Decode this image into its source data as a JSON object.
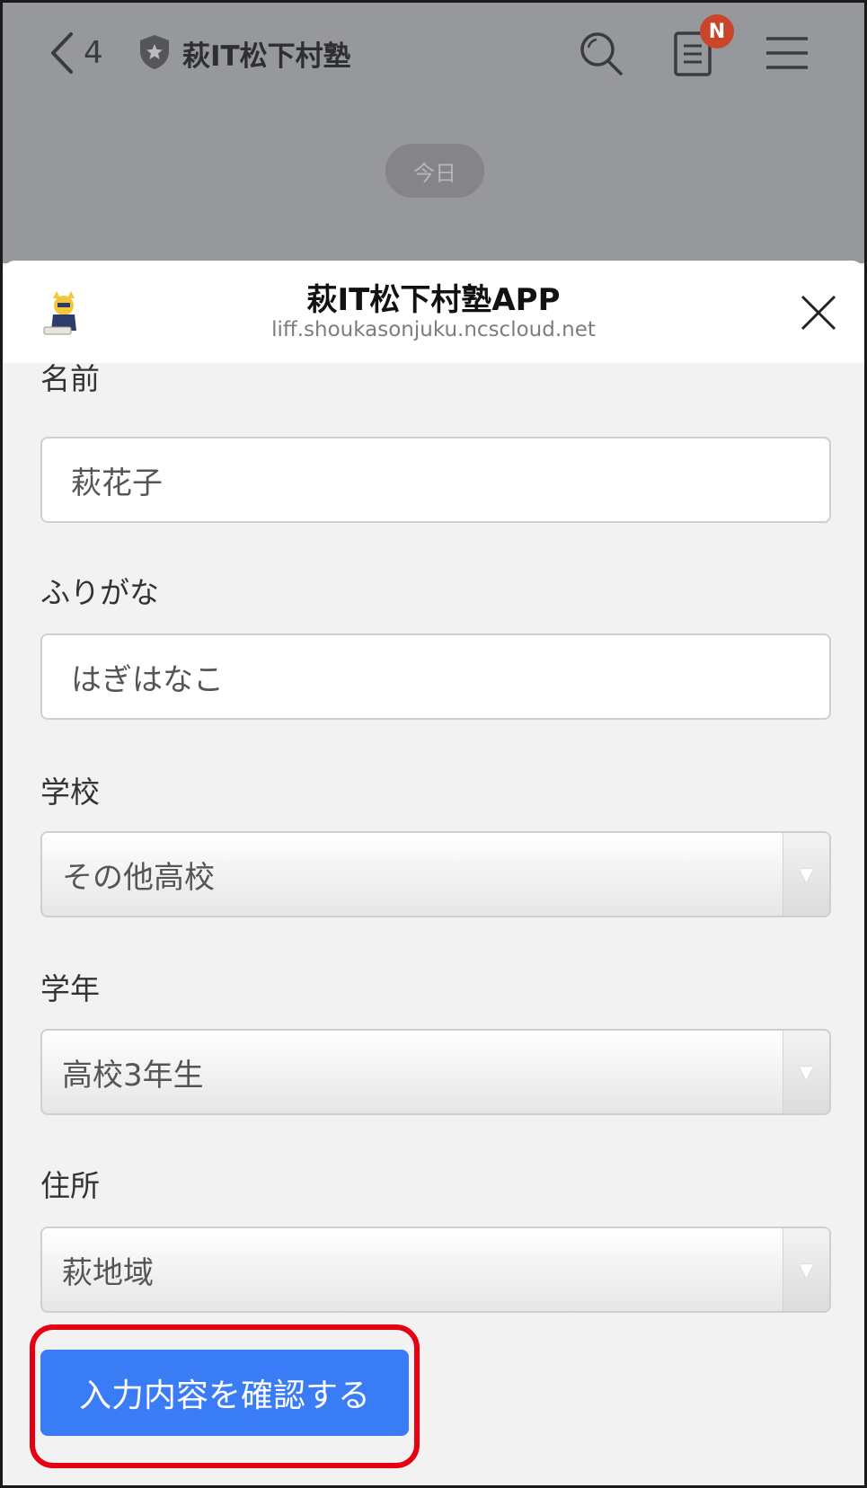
{
  "chat_header": {
    "back_count": "4",
    "title": "萩IT松下村塾",
    "notes_badge": "N",
    "date_pill": "今日"
  },
  "sheet": {
    "title": "萩IT松下村塾APP",
    "url": "liff.shoukasonjuku.ncscloud.net"
  },
  "form": {
    "name": {
      "label": "名前",
      "value": "萩花子"
    },
    "furigana": {
      "label": "ふりがな",
      "value": "はぎはなこ"
    },
    "school": {
      "label": "学校",
      "value": "その他高校"
    },
    "grade": {
      "label": "学年",
      "value": "高校3年生"
    },
    "address": {
      "label": "住所",
      "value": "萩地域"
    },
    "submit_label": "入力内容を確認する"
  },
  "colors": {
    "accent": "#3a7cf5",
    "highlight": "#e50012",
    "badge": "#c9462b"
  },
  "icons": [
    "back-chevron-icon",
    "shield-icon",
    "search-icon",
    "notes-icon",
    "menu-icon",
    "close-icon",
    "app-logo",
    "dropdown-arrow-icon"
  ]
}
